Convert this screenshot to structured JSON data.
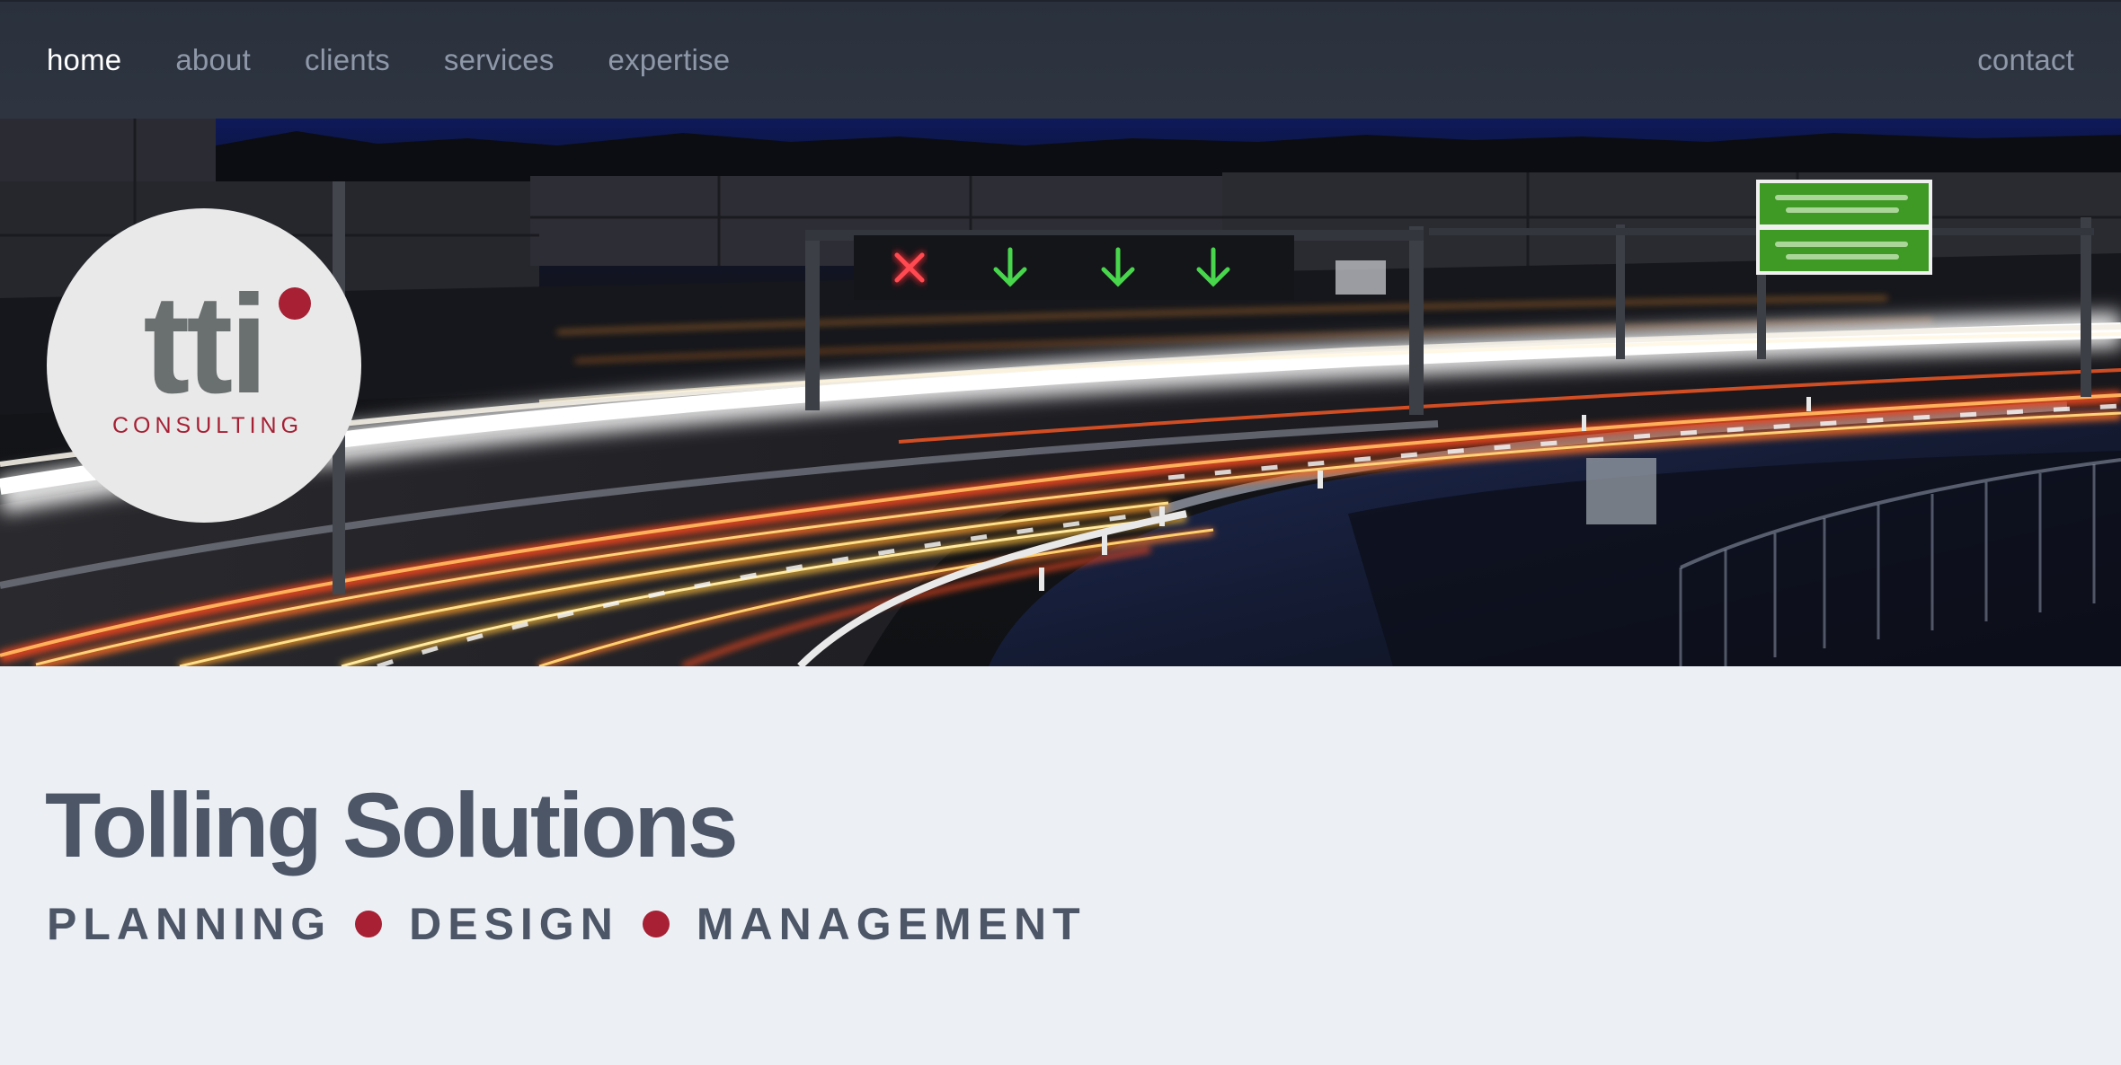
{
  "nav": {
    "items": [
      {
        "label": "home",
        "active": true
      },
      {
        "label": "about",
        "active": false
      },
      {
        "label": "clients",
        "active": false
      },
      {
        "label": "services",
        "active": false
      },
      {
        "label": "expertise",
        "active": false
      }
    ],
    "contact_label": "contact"
  },
  "hero": {
    "image": "night-highway-light-trails",
    "gantry_signals": [
      "x-icon",
      "arrow-down-icon",
      "arrow-down-icon",
      "arrow-down-icon"
    ]
  },
  "logo": {
    "mark": "tti",
    "subtitle": "CONSULTING"
  },
  "main": {
    "title": "Tolling Solutions",
    "tagline": [
      "PLANNING",
      "DESIGN",
      "MANAGEMENT"
    ]
  },
  "colors": {
    "nav_bg": "#2e3541",
    "nav_text": "#8e98a8",
    "nav_active": "#ffffff",
    "accent": "#a72034",
    "text": "#4c5667",
    "page_bg": "#eceff4"
  }
}
